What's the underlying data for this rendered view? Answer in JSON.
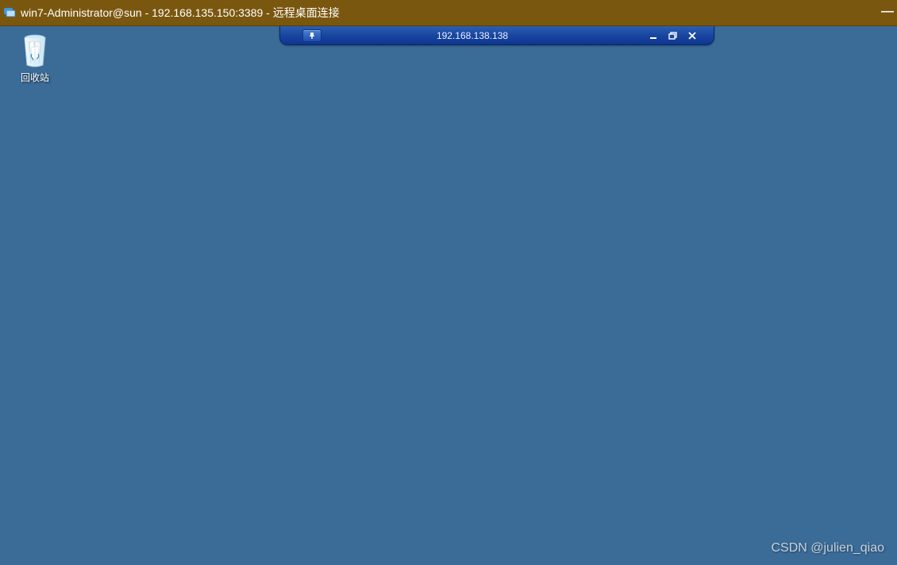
{
  "titlebar": {
    "title": "win7-Administrator@sun - 192.168.135.150:3389 - 远程桌面连接",
    "icon": "rdp-app-icon"
  },
  "rdp_bar": {
    "ip": "192.168.138.138",
    "pin_icon": "pin-icon",
    "minimize_icon": "minimize-icon",
    "restore_icon": "restore-icon",
    "close_icon": "close-icon"
  },
  "desktop": {
    "icons": [
      {
        "name": "recycle-bin",
        "label": "回收站",
        "icon": "recycle-bin-icon"
      }
    ]
  },
  "watermark": {
    "text": "CSDN @julien_qiao"
  },
  "colors": {
    "titlebar_bg": "#7a570f",
    "desktop_bg": "#3b6b97",
    "rdp_bar_bg": "#1946a0"
  }
}
